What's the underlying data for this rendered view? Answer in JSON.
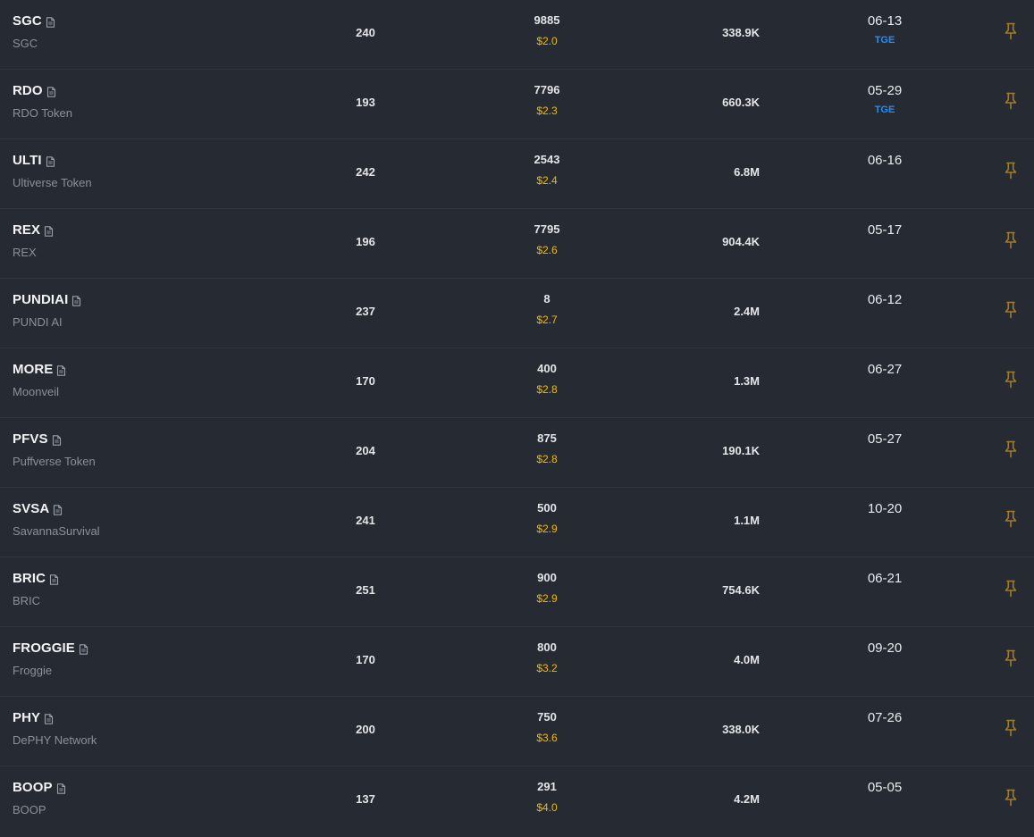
{
  "colors": {
    "background": "#262b33",
    "price": "#f0b90b",
    "tag": "#2a8bf2",
    "pin": "#a07c2a",
    "muted_text": "#8a9099"
  },
  "icons": {
    "document": "doc-icon",
    "pin": "pin-icon"
  },
  "rows": [
    {
      "symbol": "SGC",
      "name": "SGC",
      "holders": "240",
      "supply": "9885",
      "price": "$2.0",
      "volume": "338.9K",
      "date": "06-13",
      "tag": "TGE"
    },
    {
      "symbol": "RDO",
      "name": "RDO Token",
      "holders": "193",
      "supply": "7796",
      "price": "$2.3",
      "volume": "660.3K",
      "date": "05-29",
      "tag": "TGE"
    },
    {
      "symbol": "ULTI",
      "name": "Ultiverse Token",
      "holders": "242",
      "supply": "2543",
      "price": "$2.4",
      "volume": "6.8M",
      "date": "06-16",
      "tag": ""
    },
    {
      "symbol": "REX",
      "name": "REX",
      "holders": "196",
      "supply": "7795",
      "price": "$2.6",
      "volume": "904.4K",
      "date": "05-17",
      "tag": ""
    },
    {
      "symbol": "PUNDIAI",
      "name": "PUNDI AI",
      "holders": "237",
      "supply": "8",
      "price": "$2.7",
      "volume": "2.4M",
      "date": "06-12",
      "tag": ""
    },
    {
      "symbol": "MORE",
      "name": "Moonveil",
      "holders": "170",
      "supply": "400",
      "price": "$2.8",
      "volume": "1.3M",
      "date": "06-27",
      "tag": ""
    },
    {
      "symbol": "PFVS",
      "name": "Puffverse Token",
      "holders": "204",
      "supply": "875",
      "price": "$2.8",
      "volume": "190.1K",
      "date": "05-27",
      "tag": ""
    },
    {
      "symbol": "SVSA",
      "name": "SavannaSurvival",
      "holders": "241",
      "supply": "500",
      "price": "$2.9",
      "volume": "1.1M",
      "date": "10-20",
      "tag": ""
    },
    {
      "symbol": "BRIC",
      "name": "BRIC",
      "holders": "251",
      "supply": "900",
      "price": "$2.9",
      "volume": "754.6K",
      "date": "06-21",
      "tag": ""
    },
    {
      "symbol": "FROGGIE",
      "name": "Froggie",
      "holders": "170",
      "supply": "800",
      "price": "$3.2",
      "volume": "4.0M",
      "date": "09-20",
      "tag": ""
    },
    {
      "symbol": "PHY",
      "name": "DePHY Network",
      "holders": "200",
      "supply": "750",
      "price": "$3.6",
      "volume": "338.0K",
      "date": "07-26",
      "tag": ""
    },
    {
      "symbol": "BOOP",
      "name": "BOOP",
      "holders": "137",
      "supply": "291",
      "price": "$4.0",
      "volume": "4.2M",
      "date": "05-05",
      "tag": ""
    }
  ]
}
